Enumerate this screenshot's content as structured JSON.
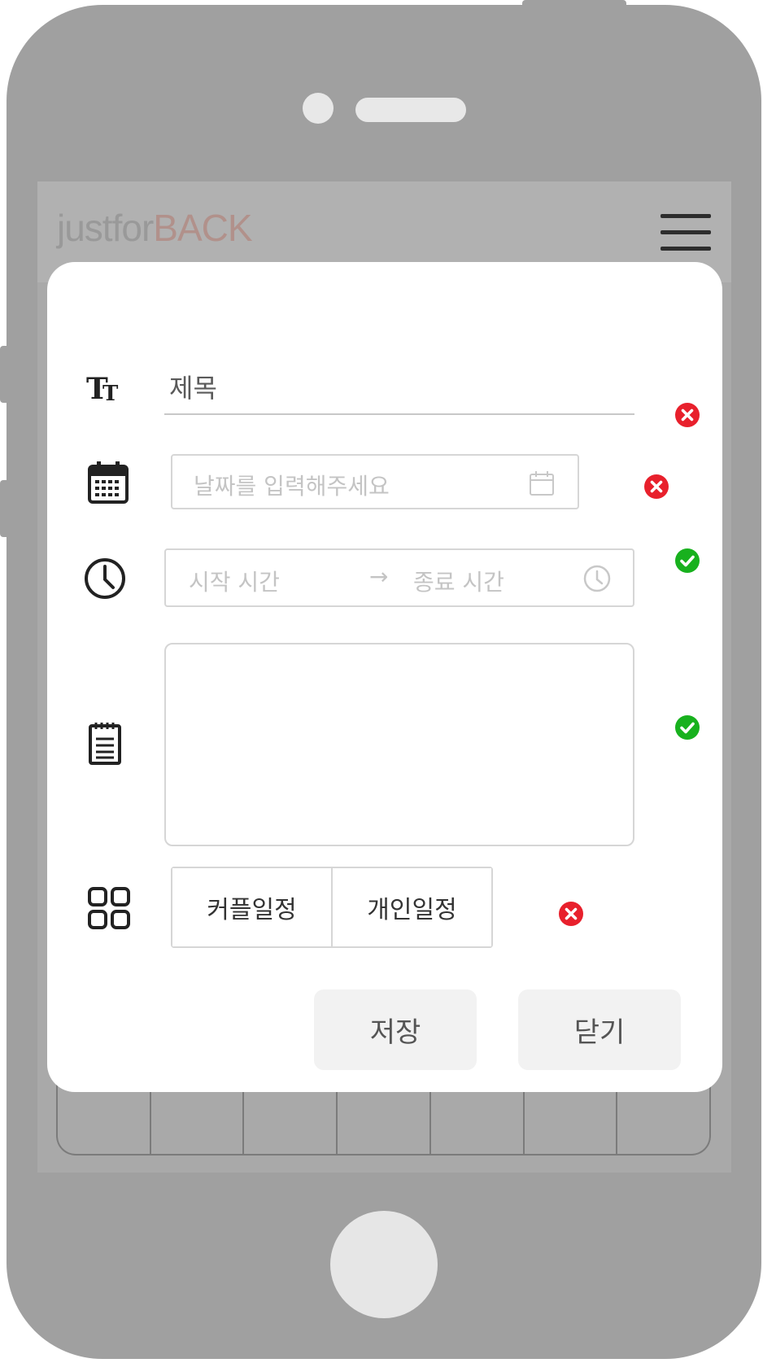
{
  "app": {
    "logo_part1": "justfor",
    "logo_part2": "BACK"
  },
  "form": {
    "title_placeholder": "제목",
    "date_placeholder": "날짜를 입력해주세요",
    "time_start_placeholder": "시작 시간",
    "time_arrow": "→",
    "time_end_placeholder": "종료 시간",
    "memo_value": "",
    "type_options": [
      "커플일정",
      "개인일정"
    ]
  },
  "status": {
    "title": "invalid",
    "date": "invalid",
    "time": "valid",
    "memo": "valid",
    "type": "invalid"
  },
  "actions": {
    "save_label": "저장",
    "close_label": "닫기"
  },
  "colors": {
    "invalid": "#e8202c",
    "valid": "#18b11e",
    "phone_body": "#a0a0a0",
    "logo_accent": "#d2aaa2"
  }
}
